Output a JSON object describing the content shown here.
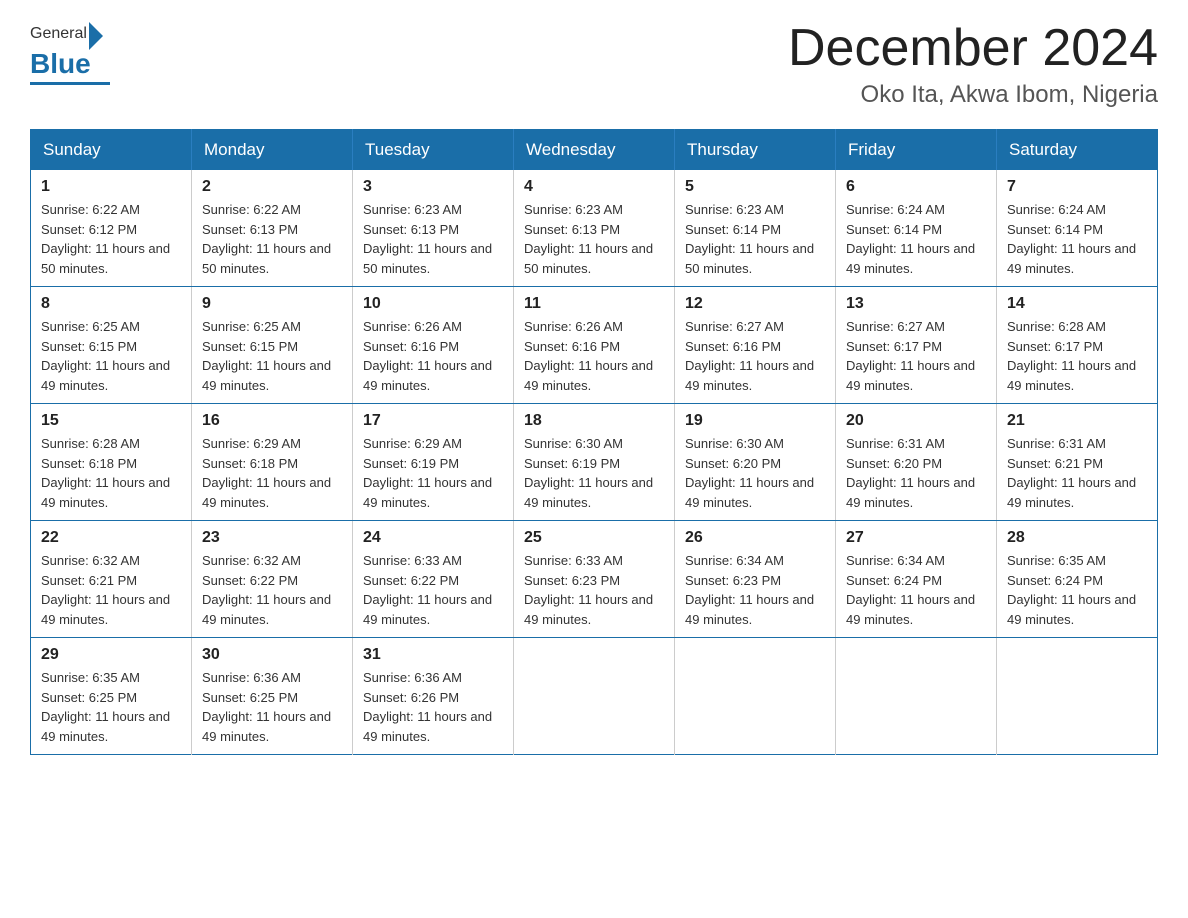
{
  "header": {
    "logo_general": "General",
    "logo_blue": "Blue",
    "month_title": "December 2024",
    "location": "Oko Ita, Akwa Ibom, Nigeria"
  },
  "weekdays": [
    "Sunday",
    "Monday",
    "Tuesday",
    "Wednesday",
    "Thursday",
    "Friday",
    "Saturday"
  ],
  "weeks": [
    [
      {
        "day": "1",
        "sunrise": "6:22 AM",
        "sunset": "6:12 PM",
        "daylight": "11 hours and 50 minutes."
      },
      {
        "day": "2",
        "sunrise": "6:22 AM",
        "sunset": "6:13 PM",
        "daylight": "11 hours and 50 minutes."
      },
      {
        "day": "3",
        "sunrise": "6:23 AM",
        "sunset": "6:13 PM",
        "daylight": "11 hours and 50 minutes."
      },
      {
        "day": "4",
        "sunrise": "6:23 AM",
        "sunset": "6:13 PM",
        "daylight": "11 hours and 50 minutes."
      },
      {
        "day": "5",
        "sunrise": "6:23 AM",
        "sunset": "6:14 PM",
        "daylight": "11 hours and 50 minutes."
      },
      {
        "day": "6",
        "sunrise": "6:24 AM",
        "sunset": "6:14 PM",
        "daylight": "11 hours and 49 minutes."
      },
      {
        "day": "7",
        "sunrise": "6:24 AM",
        "sunset": "6:14 PM",
        "daylight": "11 hours and 49 minutes."
      }
    ],
    [
      {
        "day": "8",
        "sunrise": "6:25 AM",
        "sunset": "6:15 PM",
        "daylight": "11 hours and 49 minutes."
      },
      {
        "day": "9",
        "sunrise": "6:25 AM",
        "sunset": "6:15 PM",
        "daylight": "11 hours and 49 minutes."
      },
      {
        "day": "10",
        "sunrise": "6:26 AM",
        "sunset": "6:16 PM",
        "daylight": "11 hours and 49 minutes."
      },
      {
        "day": "11",
        "sunrise": "6:26 AM",
        "sunset": "6:16 PM",
        "daylight": "11 hours and 49 minutes."
      },
      {
        "day": "12",
        "sunrise": "6:27 AM",
        "sunset": "6:16 PM",
        "daylight": "11 hours and 49 minutes."
      },
      {
        "day": "13",
        "sunrise": "6:27 AM",
        "sunset": "6:17 PM",
        "daylight": "11 hours and 49 minutes."
      },
      {
        "day": "14",
        "sunrise": "6:28 AM",
        "sunset": "6:17 PM",
        "daylight": "11 hours and 49 minutes."
      }
    ],
    [
      {
        "day": "15",
        "sunrise": "6:28 AM",
        "sunset": "6:18 PM",
        "daylight": "11 hours and 49 minutes."
      },
      {
        "day": "16",
        "sunrise": "6:29 AM",
        "sunset": "6:18 PM",
        "daylight": "11 hours and 49 minutes."
      },
      {
        "day": "17",
        "sunrise": "6:29 AM",
        "sunset": "6:19 PM",
        "daylight": "11 hours and 49 minutes."
      },
      {
        "day": "18",
        "sunrise": "6:30 AM",
        "sunset": "6:19 PM",
        "daylight": "11 hours and 49 minutes."
      },
      {
        "day": "19",
        "sunrise": "6:30 AM",
        "sunset": "6:20 PM",
        "daylight": "11 hours and 49 minutes."
      },
      {
        "day": "20",
        "sunrise": "6:31 AM",
        "sunset": "6:20 PM",
        "daylight": "11 hours and 49 minutes."
      },
      {
        "day": "21",
        "sunrise": "6:31 AM",
        "sunset": "6:21 PM",
        "daylight": "11 hours and 49 minutes."
      }
    ],
    [
      {
        "day": "22",
        "sunrise": "6:32 AM",
        "sunset": "6:21 PM",
        "daylight": "11 hours and 49 minutes."
      },
      {
        "day": "23",
        "sunrise": "6:32 AM",
        "sunset": "6:22 PM",
        "daylight": "11 hours and 49 minutes."
      },
      {
        "day": "24",
        "sunrise": "6:33 AM",
        "sunset": "6:22 PM",
        "daylight": "11 hours and 49 minutes."
      },
      {
        "day": "25",
        "sunrise": "6:33 AM",
        "sunset": "6:23 PM",
        "daylight": "11 hours and 49 minutes."
      },
      {
        "day": "26",
        "sunrise": "6:34 AM",
        "sunset": "6:23 PM",
        "daylight": "11 hours and 49 minutes."
      },
      {
        "day": "27",
        "sunrise": "6:34 AM",
        "sunset": "6:24 PM",
        "daylight": "11 hours and 49 minutes."
      },
      {
        "day": "28",
        "sunrise": "6:35 AM",
        "sunset": "6:24 PM",
        "daylight": "11 hours and 49 minutes."
      }
    ],
    [
      {
        "day": "29",
        "sunrise": "6:35 AM",
        "sunset": "6:25 PM",
        "daylight": "11 hours and 49 minutes."
      },
      {
        "day": "30",
        "sunrise": "6:36 AM",
        "sunset": "6:25 PM",
        "daylight": "11 hours and 49 minutes."
      },
      {
        "day": "31",
        "sunrise": "6:36 AM",
        "sunset": "6:26 PM",
        "daylight": "11 hours and 49 minutes."
      },
      null,
      null,
      null,
      null
    ]
  ]
}
